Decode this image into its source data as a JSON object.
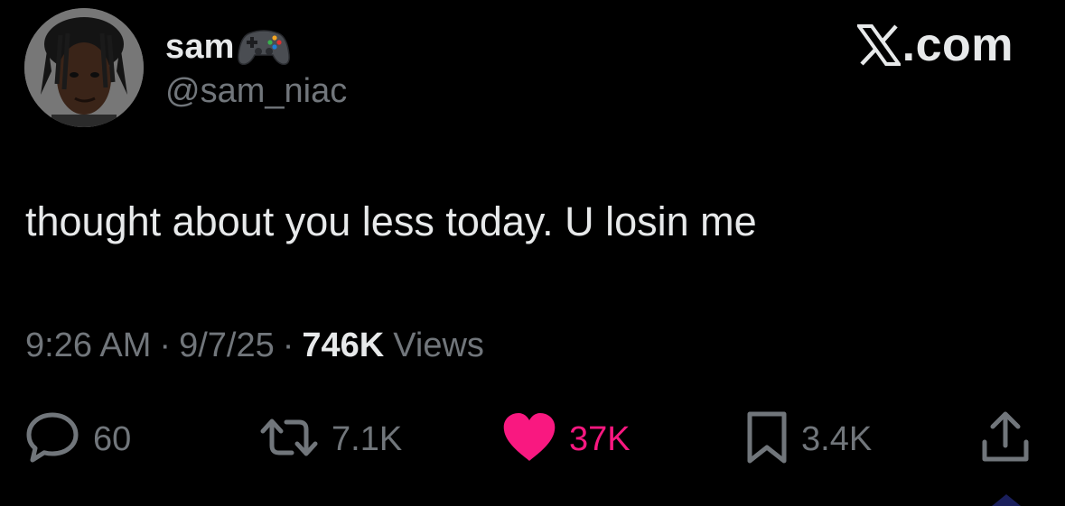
{
  "author": {
    "display_name": "sam",
    "name_emoji": "video-game-controller-icon",
    "handle": "@sam_niac",
    "avatar": "profile-photo"
  },
  "brand": {
    "label": ".com",
    "logo": "x-logo-icon"
  },
  "tweet": {
    "text": "thought about you less today. U losin me"
  },
  "meta": {
    "time": "9:26 AM",
    "separator": "·",
    "date": "9/7/25",
    "views_count": "746K",
    "views_label": "Views"
  },
  "actions": {
    "replies": {
      "icon": "reply-icon",
      "count": "60"
    },
    "reposts": {
      "icon": "repost-icon",
      "count": "7.1K"
    },
    "likes": {
      "icon": "heart-icon",
      "count": "37K",
      "liked": true
    },
    "bookmarks": {
      "icon": "bookmark-icon",
      "count": "3.4K"
    },
    "share": {
      "icon": "share-icon"
    }
  },
  "colors": {
    "background": "#000000",
    "primary_text": "#e7e9ea",
    "secondary_text": "#71767b",
    "like_pink": "#f91880"
  }
}
